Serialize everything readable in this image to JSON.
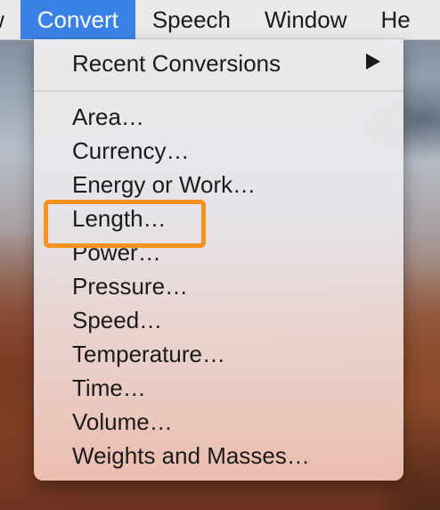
{
  "menubar": {
    "items": [
      {
        "label": "w"
      },
      {
        "label": "Convert"
      },
      {
        "label": "Speech"
      },
      {
        "label": "Window"
      },
      {
        "label": "He"
      }
    ],
    "active_color": "#3b82e6"
  },
  "menu": {
    "recent": "Recent Conversions",
    "items": [
      "Area…",
      "Currency…",
      "Energy or Work…",
      "Length…",
      "Power…",
      "Pressure…",
      "Speed…",
      "Temperature…",
      "Time…",
      "Volume…",
      "Weights and Masses…"
    ]
  },
  "annotation": {
    "highlighted_item": "Length…",
    "color": "#f7921e"
  }
}
